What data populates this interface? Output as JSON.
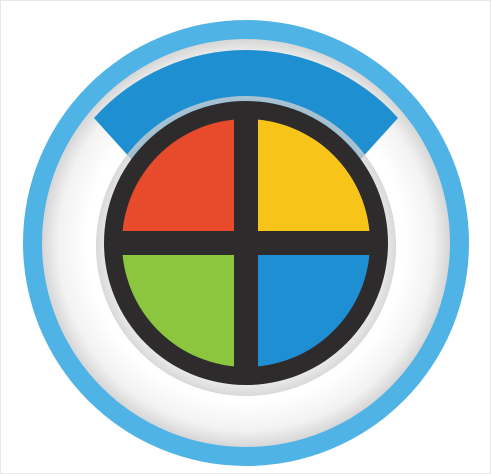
{
  "icon": {
    "name": "color-wheel-app-icon",
    "colors": {
      "outer_ring": "#4FB3E6",
      "ring_highlight": "#1E8FD0",
      "inner_ring_white": "#FFFFFF",
      "inner_ring_shadow": "#D9D9D9",
      "dial_border": "#2E2B2C",
      "quadrant_top_left": "#E84A2C",
      "quadrant_top_right": "#F7C51A",
      "quadrant_bottom_left": "#8CC63F",
      "quadrant_bottom_right": "#1F8FD3"
    }
  }
}
